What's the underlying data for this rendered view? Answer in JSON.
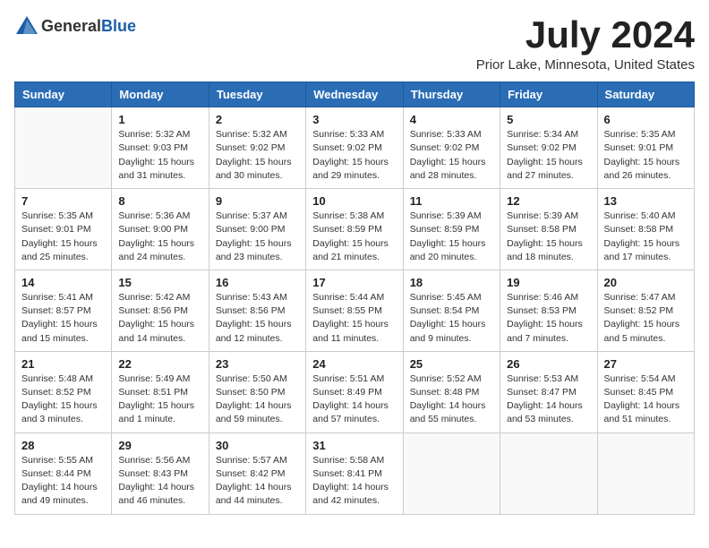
{
  "header": {
    "logo_line1": "General",
    "logo_line2": "Blue",
    "title": "July 2024",
    "subtitle": "Prior Lake, Minnesota, United States"
  },
  "calendar": {
    "headers": [
      "Sunday",
      "Monday",
      "Tuesday",
      "Wednesday",
      "Thursday",
      "Friday",
      "Saturday"
    ],
    "weeks": [
      [
        {
          "day": "",
          "sunrise": "",
          "sunset": "",
          "daylight": ""
        },
        {
          "day": "1",
          "sunrise": "Sunrise: 5:32 AM",
          "sunset": "Sunset: 9:03 PM",
          "daylight": "Daylight: 15 hours and 31 minutes."
        },
        {
          "day": "2",
          "sunrise": "Sunrise: 5:32 AM",
          "sunset": "Sunset: 9:02 PM",
          "daylight": "Daylight: 15 hours and 30 minutes."
        },
        {
          "day": "3",
          "sunrise": "Sunrise: 5:33 AM",
          "sunset": "Sunset: 9:02 PM",
          "daylight": "Daylight: 15 hours and 29 minutes."
        },
        {
          "day": "4",
          "sunrise": "Sunrise: 5:33 AM",
          "sunset": "Sunset: 9:02 PM",
          "daylight": "Daylight: 15 hours and 28 minutes."
        },
        {
          "day": "5",
          "sunrise": "Sunrise: 5:34 AM",
          "sunset": "Sunset: 9:02 PM",
          "daylight": "Daylight: 15 hours and 27 minutes."
        },
        {
          "day": "6",
          "sunrise": "Sunrise: 5:35 AM",
          "sunset": "Sunset: 9:01 PM",
          "daylight": "Daylight: 15 hours and 26 minutes."
        }
      ],
      [
        {
          "day": "7",
          "sunrise": "Sunrise: 5:35 AM",
          "sunset": "Sunset: 9:01 PM",
          "daylight": "Daylight: 15 hours and 25 minutes."
        },
        {
          "day": "8",
          "sunrise": "Sunrise: 5:36 AM",
          "sunset": "Sunset: 9:00 PM",
          "daylight": "Daylight: 15 hours and 24 minutes."
        },
        {
          "day": "9",
          "sunrise": "Sunrise: 5:37 AM",
          "sunset": "Sunset: 9:00 PM",
          "daylight": "Daylight: 15 hours and 23 minutes."
        },
        {
          "day": "10",
          "sunrise": "Sunrise: 5:38 AM",
          "sunset": "Sunset: 8:59 PM",
          "daylight": "Daylight: 15 hours and 21 minutes."
        },
        {
          "day": "11",
          "sunrise": "Sunrise: 5:39 AM",
          "sunset": "Sunset: 8:59 PM",
          "daylight": "Daylight: 15 hours and 20 minutes."
        },
        {
          "day": "12",
          "sunrise": "Sunrise: 5:39 AM",
          "sunset": "Sunset: 8:58 PM",
          "daylight": "Daylight: 15 hours and 18 minutes."
        },
        {
          "day": "13",
          "sunrise": "Sunrise: 5:40 AM",
          "sunset": "Sunset: 8:58 PM",
          "daylight": "Daylight: 15 hours and 17 minutes."
        }
      ],
      [
        {
          "day": "14",
          "sunrise": "Sunrise: 5:41 AM",
          "sunset": "Sunset: 8:57 PM",
          "daylight": "Daylight: 15 hours and 15 minutes."
        },
        {
          "day": "15",
          "sunrise": "Sunrise: 5:42 AM",
          "sunset": "Sunset: 8:56 PM",
          "daylight": "Daylight: 15 hours and 14 minutes."
        },
        {
          "day": "16",
          "sunrise": "Sunrise: 5:43 AM",
          "sunset": "Sunset: 8:56 PM",
          "daylight": "Daylight: 15 hours and 12 minutes."
        },
        {
          "day": "17",
          "sunrise": "Sunrise: 5:44 AM",
          "sunset": "Sunset: 8:55 PM",
          "daylight": "Daylight: 15 hours and 11 minutes."
        },
        {
          "day": "18",
          "sunrise": "Sunrise: 5:45 AM",
          "sunset": "Sunset: 8:54 PM",
          "daylight": "Daylight: 15 hours and 9 minutes."
        },
        {
          "day": "19",
          "sunrise": "Sunrise: 5:46 AM",
          "sunset": "Sunset: 8:53 PM",
          "daylight": "Daylight: 15 hours and 7 minutes."
        },
        {
          "day": "20",
          "sunrise": "Sunrise: 5:47 AM",
          "sunset": "Sunset: 8:52 PM",
          "daylight": "Daylight: 15 hours and 5 minutes."
        }
      ],
      [
        {
          "day": "21",
          "sunrise": "Sunrise: 5:48 AM",
          "sunset": "Sunset: 8:52 PM",
          "daylight": "Daylight: 15 hours and 3 minutes."
        },
        {
          "day": "22",
          "sunrise": "Sunrise: 5:49 AM",
          "sunset": "Sunset: 8:51 PM",
          "daylight": "Daylight: 15 hours and 1 minute."
        },
        {
          "day": "23",
          "sunrise": "Sunrise: 5:50 AM",
          "sunset": "Sunset: 8:50 PM",
          "daylight": "Daylight: 14 hours and 59 minutes."
        },
        {
          "day": "24",
          "sunrise": "Sunrise: 5:51 AM",
          "sunset": "Sunset: 8:49 PM",
          "daylight": "Daylight: 14 hours and 57 minutes."
        },
        {
          "day": "25",
          "sunrise": "Sunrise: 5:52 AM",
          "sunset": "Sunset: 8:48 PM",
          "daylight": "Daylight: 14 hours and 55 minutes."
        },
        {
          "day": "26",
          "sunrise": "Sunrise: 5:53 AM",
          "sunset": "Sunset: 8:47 PM",
          "daylight": "Daylight: 14 hours and 53 minutes."
        },
        {
          "day": "27",
          "sunrise": "Sunrise: 5:54 AM",
          "sunset": "Sunset: 8:45 PM",
          "daylight": "Daylight: 14 hours and 51 minutes."
        }
      ],
      [
        {
          "day": "28",
          "sunrise": "Sunrise: 5:55 AM",
          "sunset": "Sunset: 8:44 PM",
          "daylight": "Daylight: 14 hours and 49 minutes."
        },
        {
          "day": "29",
          "sunrise": "Sunrise: 5:56 AM",
          "sunset": "Sunset: 8:43 PM",
          "daylight": "Daylight: 14 hours and 46 minutes."
        },
        {
          "day": "30",
          "sunrise": "Sunrise: 5:57 AM",
          "sunset": "Sunset: 8:42 PM",
          "daylight": "Daylight: 14 hours and 44 minutes."
        },
        {
          "day": "31",
          "sunrise": "Sunrise: 5:58 AM",
          "sunset": "Sunset: 8:41 PM",
          "daylight": "Daylight: 14 hours and 42 minutes."
        },
        {
          "day": "",
          "sunrise": "",
          "sunset": "",
          "daylight": ""
        },
        {
          "day": "",
          "sunrise": "",
          "sunset": "",
          "daylight": ""
        },
        {
          "day": "",
          "sunrise": "",
          "sunset": "",
          "daylight": ""
        }
      ]
    ]
  }
}
